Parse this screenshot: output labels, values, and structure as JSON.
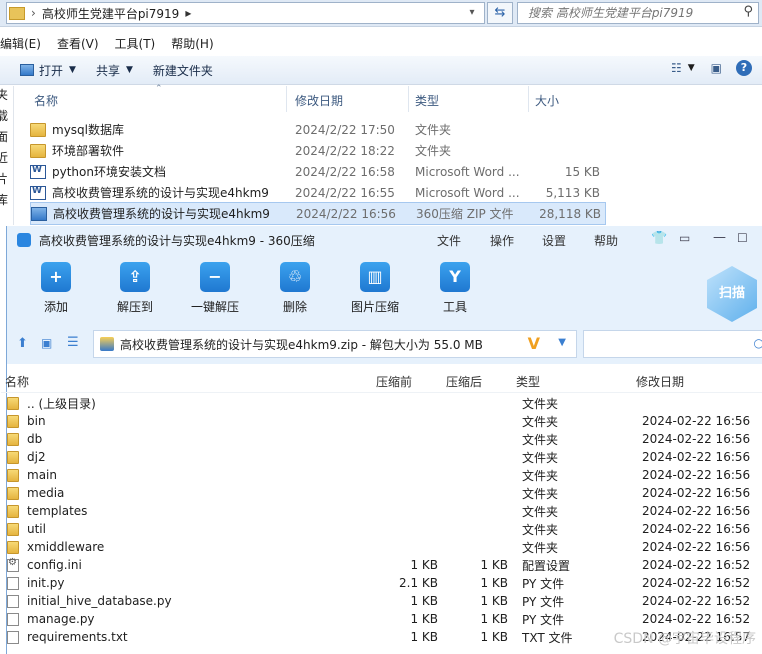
{
  "explorer": {
    "breadcrumb": "高校师生党建平台pi7919",
    "search_placeholder": "搜索 高校师生党建平台pi7919",
    "menu": [
      "编辑(E)",
      "查看(V)",
      "工具(T)",
      "帮助(H)"
    ],
    "toolbar": {
      "open": "打开",
      "share": "共享",
      "new_folder": "新建文件夹"
    },
    "columns": {
      "name": "名称",
      "date": "修改日期",
      "type": "类型",
      "size": "大小"
    },
    "nav_chars": [
      "夹",
      "载",
      "面",
      "近",
      "片",
      "库"
    ],
    "files": [
      {
        "icon": "folder-icon",
        "name": "mysql数据库",
        "date": "2024/2/22 17:50",
        "type": "文件夹",
        "size": ""
      },
      {
        "icon": "folder-icon",
        "name": "环境部署软件",
        "date": "2024/2/22 18:22",
        "type": "文件夹",
        "size": ""
      },
      {
        "icon": "word-doc-icon",
        "name": "python环境安装文档",
        "date": "2024/2/22 16:58",
        "type": "Microsoft Word ...",
        "size": "15 KB"
      },
      {
        "icon": "word-doc-icon",
        "name": "高校收费管理系统的设计与实现e4hkm9",
        "date": "2024/2/22 16:55",
        "type": "Microsoft Word ...",
        "size": "5,113 KB"
      },
      {
        "icon": "zip-file-icon",
        "name": "高校收费管理系统的设计与实现e4hkm9",
        "date": "2024/2/22 16:56",
        "type": "360压缩 ZIP 文件",
        "size": "28,118 KB"
      }
    ]
  },
  "zip": {
    "title": "高校收费管理系统的设计与实现e4hkm9 - 360压缩",
    "menu": [
      "文件",
      "操作",
      "设置",
      "帮助"
    ],
    "tools": [
      {
        "label": "添加",
        "icon": "add-icon"
      },
      {
        "label": "解压到",
        "icon": "extract-to-icon"
      },
      {
        "label": "一键解压",
        "icon": "quick-extract-icon"
      },
      {
        "label": "删除",
        "icon": "delete-icon"
      },
      {
        "label": "图片压缩",
        "icon": "image-compress-icon"
      },
      {
        "label": "工具",
        "icon": "tools-icon"
      }
    ],
    "scan_label": "扫描",
    "path": "高校收费管理系统的设计与实现e4hkm9.zip - 解包大小为 55.0 MB",
    "columns": {
      "name": "名称",
      "packed": "压缩前",
      "compressed": "压缩后",
      "type": "类型",
      "date": "修改日期"
    },
    "rows": [
      {
        "icon": "folder",
        "name": ".. (上级目录)",
        "c1": "",
        "c2": "",
        "type": "文件夹",
        "date": ""
      },
      {
        "icon": "folder",
        "name": "bin",
        "c1": "",
        "c2": "",
        "type": "文件夹",
        "date": "2024-02-22 16:56"
      },
      {
        "icon": "folder",
        "name": "db",
        "c1": "",
        "c2": "",
        "type": "文件夹",
        "date": "2024-02-22 16:56"
      },
      {
        "icon": "folder",
        "name": "dj2",
        "c1": "",
        "c2": "",
        "type": "文件夹",
        "date": "2024-02-22 16:56"
      },
      {
        "icon": "folder",
        "name": "main",
        "c1": "",
        "c2": "",
        "type": "文件夹",
        "date": "2024-02-22 16:56"
      },
      {
        "icon": "folder",
        "name": "media",
        "c1": "",
        "c2": "",
        "type": "文件夹",
        "date": "2024-02-22 16:56"
      },
      {
        "icon": "folder",
        "name": "templates",
        "c1": "",
        "c2": "",
        "type": "文件夹",
        "date": "2024-02-22 16:56"
      },
      {
        "icon": "folder",
        "name": "util",
        "c1": "",
        "c2": "",
        "type": "文件夹",
        "date": "2024-02-22 16:56"
      },
      {
        "icon": "folder",
        "name": "xmiddleware",
        "c1": "",
        "c2": "",
        "type": "文件夹",
        "date": "2024-02-22 16:56"
      },
      {
        "icon": "gear",
        "name": "config.ini",
        "c1": "1 KB",
        "c2": "1 KB",
        "type": "配置设置",
        "date": "2024-02-22 16:52"
      },
      {
        "icon": "doc",
        "name": "init.py",
        "c1": "2.1 KB",
        "c2": "1 KB",
        "type": "PY 文件",
        "date": "2024-02-22 16:52"
      },
      {
        "icon": "doc",
        "name": "initial_hive_database.py",
        "c1": "1 KB",
        "c2": "1 KB",
        "type": "PY 文件",
        "date": "2024-02-22 16:52"
      },
      {
        "icon": "doc",
        "name": "manage.py",
        "c1": "1 KB",
        "c2": "1 KB",
        "type": "PY 文件",
        "date": "2024-02-22 16:52"
      },
      {
        "icon": "doc",
        "name": "requirements.txt",
        "c1": "1 KB",
        "c2": "1 KB",
        "type": "TXT 文件",
        "date": "2024-02-22 16:57"
      }
    ]
  },
  "watermark": "CSDN @宇宙毕设程序"
}
